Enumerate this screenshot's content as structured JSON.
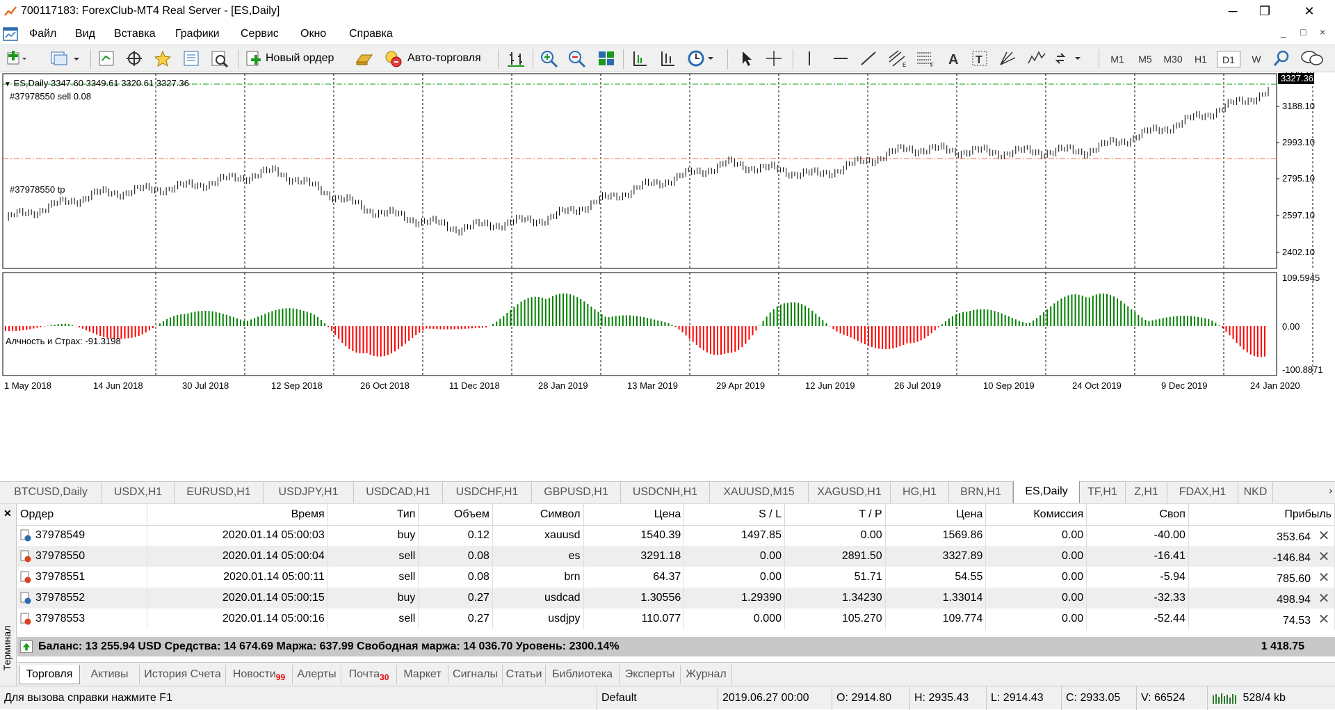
{
  "window": {
    "title": "700117183: ForexClub-MT4 Real Server - [ES,Daily]",
    "minimize": "─",
    "restore": "❐",
    "close": "✕"
  },
  "menu": {
    "items": [
      "Файл",
      "Вид",
      "Вставка",
      "Графики",
      "Сервис",
      "Окно",
      "Справка"
    ],
    "right_buttons": [
      "_",
      "□",
      "×"
    ]
  },
  "toolbar": {
    "new_order": "Новый ордер",
    "auto_trading": "Авто-торговля",
    "timeframes": [
      "M1",
      "M5",
      "M30",
      "H1",
      "D1",
      "W"
    ],
    "active_timeframe": "D1"
  },
  "chart": {
    "info": "ES,Daily  3347.60 3349.61 3320.61 3327.36",
    "order_line_label": "#37978550 sell 0.08",
    "tp_line_label": "#37978550 tp",
    "current_price": "3327.36",
    "price_axis": [
      "3386.10",
      "3188.10",
      "2993.10",
      "2795.10",
      "2597.10",
      "2402.10"
    ],
    "indicator_label": "Алчность и Страх: -91.3198",
    "indicator_axis": [
      "109.5945",
      "0.00",
      "-100.8871"
    ],
    "date_axis": [
      "1 May 2018",
      "14 Jun 2018",
      "30 Jul 2018",
      "12 Sep 2018",
      "26 Oct 2018",
      "11 Dec 2018",
      "28 Jan 2019",
      "13 Mar 2019",
      "29 Apr 2019",
      "12 Jun 2019",
      "26 Jul 2019",
      "10 Sep 2019",
      "24 Oct 2019",
      "9 Dec 2019",
      "24 Jan 2020"
    ],
    "colors": {
      "up": "#008000",
      "down": "#ff0000",
      "order_line": "#00a000",
      "tp_line": "#ff6633",
      "grid": "#000000"
    }
  },
  "chart_data": {
    "type": "line",
    "title": "ES,Daily",
    "series": [
      {
        "name": "ES,Daily",
        "x": [
          "1 May 2018",
          "14 Jun 2018",
          "30 Jul 2018",
          "12 Sep 2018",
          "26 Oct 2018",
          "11 Dec 2018",
          "28 Jan 2019",
          "13 Mar 2019",
          "29 Apr 2019",
          "12 Jun 2019",
          "26 Jul 2019",
          "10 Sep 2019",
          "24 Oct 2019",
          "9 Dec 2019",
          "24 Jan 2020"
        ],
        "values": [
          2650,
          2780,
          2820,
          2900,
          2700,
          2600,
          2650,
          2810,
          2940,
          2880,
          3020,
          3000,
          3010,
          3150,
          3320
        ]
      }
    ],
    "ylim": [
      2402.1,
      3386.1
    ],
    "indicator": {
      "name": "Алчность и Страх",
      "values": [
        -20,
        10,
        -50,
        50,
        20,
        60,
        -110,
        -10,
        -5,
        110,
        35,
        15,
        -110,
        95,
        -40,
        -70,
        60,
        10,
        115,
        20,
        30,
        -120
      ]
    }
  },
  "chart_tabs": [
    {
      "label": "BTCUSD,Daily"
    },
    {
      "label": "USDX,H1"
    },
    {
      "label": "EURUSD,H1"
    },
    {
      "label": "USDJPY,H1"
    },
    {
      "label": "USDCAD,H1"
    },
    {
      "label": "USDCHF,H1"
    },
    {
      "label": "GBPUSD,H1"
    },
    {
      "label": "USDCNH,H1"
    },
    {
      "label": "XAUUSD,M15"
    },
    {
      "label": "XAGUSD,H1"
    },
    {
      "label": "HG,H1"
    },
    {
      "label": "BRN,H1"
    },
    {
      "label": "ES,Daily",
      "active": true
    },
    {
      "label": "TF,H1"
    },
    {
      "label": "Z,H1"
    },
    {
      "label": "FDAX,H1"
    },
    {
      "label": "NKD"
    }
  ],
  "terminal": {
    "side_label": "Терминал",
    "columns": [
      "Ордер",
      "Время",
      "Тип",
      "Объем",
      "Символ",
      "Цена",
      "S / L",
      "T / P",
      "Цена",
      "Комиссия",
      "Своп",
      "Прибыль"
    ],
    "rows": [
      {
        "order": "37978549",
        "time": "2020.01.14 05:00:03",
        "type": "buy",
        "volume": "0.12",
        "symbol": "xauusd",
        "price": "1540.39",
        "sl": "1497.85",
        "tp": "0.00",
        "cur": "1569.86",
        "comm": "0.00",
        "swap": "-40.00",
        "profit": "353.64"
      },
      {
        "order": "37978550",
        "time": "2020.01.14 05:00:04",
        "type": "sell",
        "volume": "0.08",
        "symbol": "es",
        "price": "3291.18",
        "sl": "0.00",
        "tp": "2891.50",
        "cur": "3327.89",
        "comm": "0.00",
        "swap": "-16.41",
        "profit": "-146.84"
      },
      {
        "order": "37978551",
        "time": "2020.01.14 05:00:11",
        "type": "sell",
        "volume": "0.08",
        "symbol": "brn",
        "price": "64.37",
        "sl": "0.00",
        "tp": "51.71",
        "cur": "54.55",
        "comm": "0.00",
        "swap": "-5.94",
        "profit": "785.60"
      },
      {
        "order": "37978552",
        "time": "2020.01.14 05:00:15",
        "type": "buy",
        "volume": "0.27",
        "symbol": "usdcad",
        "price": "1.30556",
        "sl": "1.29390",
        "tp": "1.34230",
        "cur": "1.33014",
        "comm": "0.00",
        "swap": "-32.33",
        "profit": "498.94"
      },
      {
        "order": "37978553",
        "time": "2020.01.14 05:00:16",
        "type": "sell",
        "volume": "0.27",
        "symbol": "usdjpy",
        "price": "110.077",
        "sl": "0.000",
        "tp": "105.270",
        "cur": "109.774",
        "comm": "0.00",
        "swap": "-52.44",
        "profit": "74.53"
      }
    ],
    "balance": "Баланс: 13 255.94 USD  Средства: 14 674.69  Маржа: 637.99  Свободная маржа: 14 036.70  Уровень: 2300.14%",
    "total_profit": "1 418.75",
    "tabs": [
      {
        "label": "Торговля",
        "active": true
      },
      {
        "label": "Активы"
      },
      {
        "label": "История Счета"
      },
      {
        "label": "Новости",
        "badge": "99"
      },
      {
        "label": "Алерты"
      },
      {
        "label": "Почта",
        "badge": "30"
      },
      {
        "label": "Маркет"
      },
      {
        "label": "Сигналы"
      },
      {
        "label": "Статьи"
      },
      {
        "label": "Библиотека"
      },
      {
        "label": "Эксперты"
      },
      {
        "label": "Журнал"
      }
    ]
  },
  "status": {
    "help": "Для вызова справки нажмите F1",
    "profile": "Default",
    "datetime": "2019.06.27 00:00",
    "open": "O: 2914.80",
    "high": "H: 2935.43",
    "low": "L: 2914.43",
    "close": "C: 2933.05",
    "volume": "V: 66524",
    "traffic": "528/4 kb"
  }
}
